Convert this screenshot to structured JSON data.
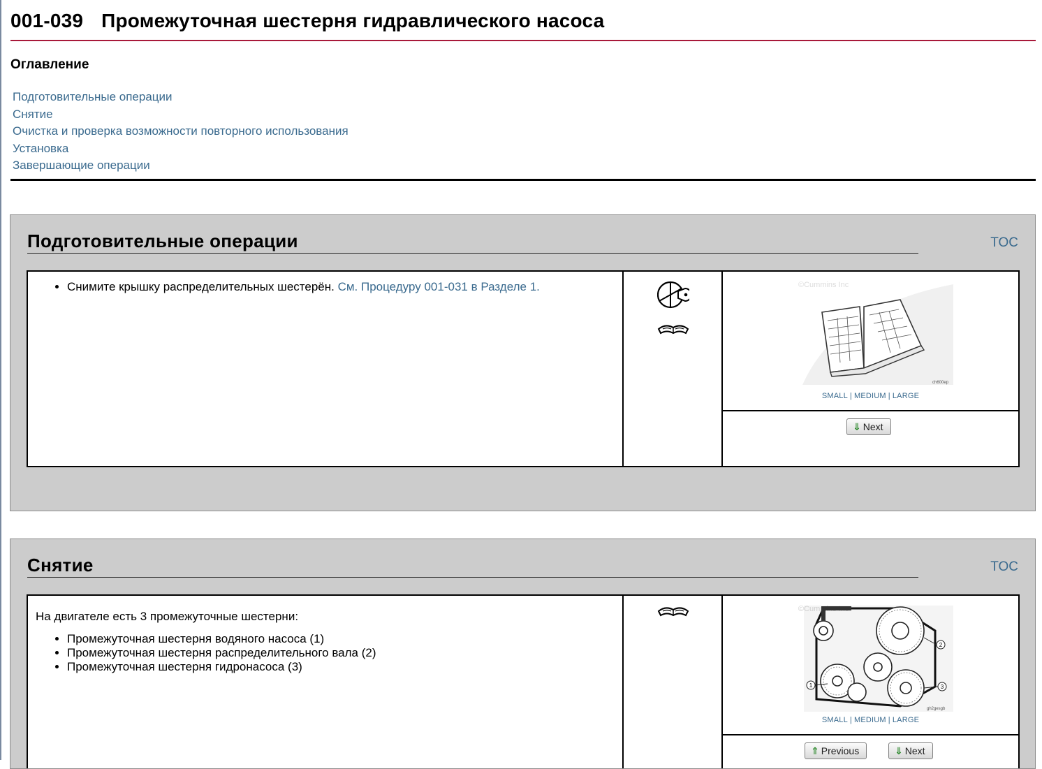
{
  "document": {
    "code": "001-039",
    "title": "Промежуточная шестерня гидравлического насоса"
  },
  "toc": {
    "heading": "Оглавление",
    "items": [
      "Подготовительные операции",
      "Снятие",
      "Очистка и проверка возможности повторного использования",
      "Установка",
      "Завершающие операции"
    ]
  },
  "sections": [
    {
      "title": "Подготовительные операции",
      "toc_link": "TOC",
      "bullet_prefix": "Снимите крышку распределительных шестерён. ",
      "bullet_link": "См. Процедуру 001-031 в Разделе 1.",
      "icons": [
        "wrench-in-circle-icon",
        "open-manual-icon"
      ],
      "figure": {
        "watermark": "©Cummins Inc",
        "code": "ch600ep",
        "alt": "manual-book-figure"
      },
      "size_links": [
        "SMALL",
        "MEDIUM",
        "LARGE"
      ],
      "next_label": "Next"
    },
    {
      "title": "Снятие",
      "toc_link": "TOC",
      "intro": "На двигателе есть 3 промежуточные шестерни:",
      "bullets": [
        "Промежуточная шестерня водяного насоса (1)",
        "Промежуточная шестерня распределительного вала (2)",
        "Промежуточная шестерня гидронасоса (3)"
      ],
      "icons": [
        "open-manual-icon"
      ],
      "figure": {
        "watermark": "©Cummins Inc",
        "code": "gh2gesgb",
        "alt": "gear-train-figure",
        "callouts": [
          "1",
          "2",
          "3"
        ]
      },
      "size_links": [
        "SMALL",
        "MEDIUM",
        "LARGE"
      ],
      "previous_label": "Previous",
      "next_label": "Next"
    }
  ],
  "colors": {
    "link": "#3a6a8e",
    "title_rule": "#a8193a",
    "section_bg": "#cccccc",
    "button_arrow": "#2f8a2f"
  }
}
